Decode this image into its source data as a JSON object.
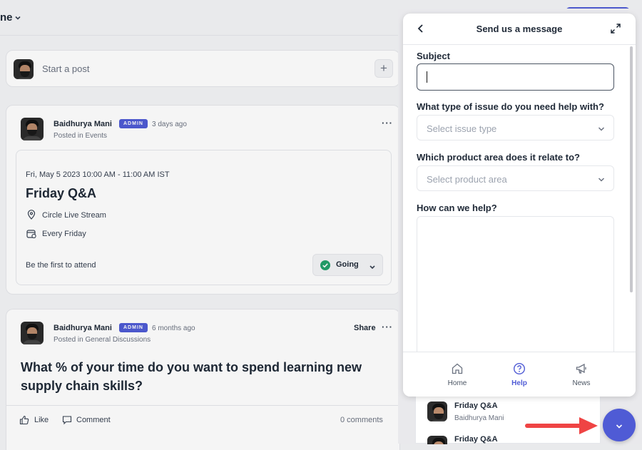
{
  "topbar": {
    "title_fragment": "ne"
  },
  "composer": {
    "placeholder": "Start a post"
  },
  "post1": {
    "author": "Baidhurya Mani",
    "badge": "ADMIN",
    "time": "3 days ago",
    "posted_in": "Posted in Events",
    "event": {
      "datetime": "Fri, May 5 2023 10:00 AM - 11:00 AM IST",
      "title": "Friday Q&A",
      "location": "Circle Live Stream",
      "recurrence": "Every Friday",
      "attend_text": "Be the first to attend",
      "rsvp_label": "Going"
    }
  },
  "post2": {
    "author": "Baidhurya Mani",
    "badge": "ADMIN",
    "time": "6 months ago",
    "posted_in": "Posted in General Discussions",
    "share_label": "Share",
    "title": "What % of your time do you want to spend learning new supply chain skills?",
    "like_label": "Like",
    "comment_label": "Comment",
    "comments_count": "0 comments"
  },
  "widget": {
    "header_title": "Send us a message",
    "subject_label": "Subject",
    "issue_label": "What type of issue do you need help with?",
    "issue_placeholder": "Select issue type",
    "area_label": "Which product area does it relate to?",
    "area_placeholder": "Select product area",
    "help_label": "How can we help?",
    "tabs": [
      {
        "label": "Home",
        "icon": "home-icon",
        "active": false
      },
      {
        "label": "Help",
        "icon": "help-icon",
        "active": true
      },
      {
        "label": "News",
        "icon": "megaphone-icon",
        "active": false
      }
    ],
    "accent": "#4f5bd5"
  },
  "behind_panel": {
    "item1_title": "Friday Q&A",
    "item1_author": "Baidhurya Mani",
    "item2_title": "Friday Q&A"
  },
  "colors": {
    "launcher": "#4f5bd5",
    "arrow": "#ef4444",
    "going": "#22a06b"
  }
}
